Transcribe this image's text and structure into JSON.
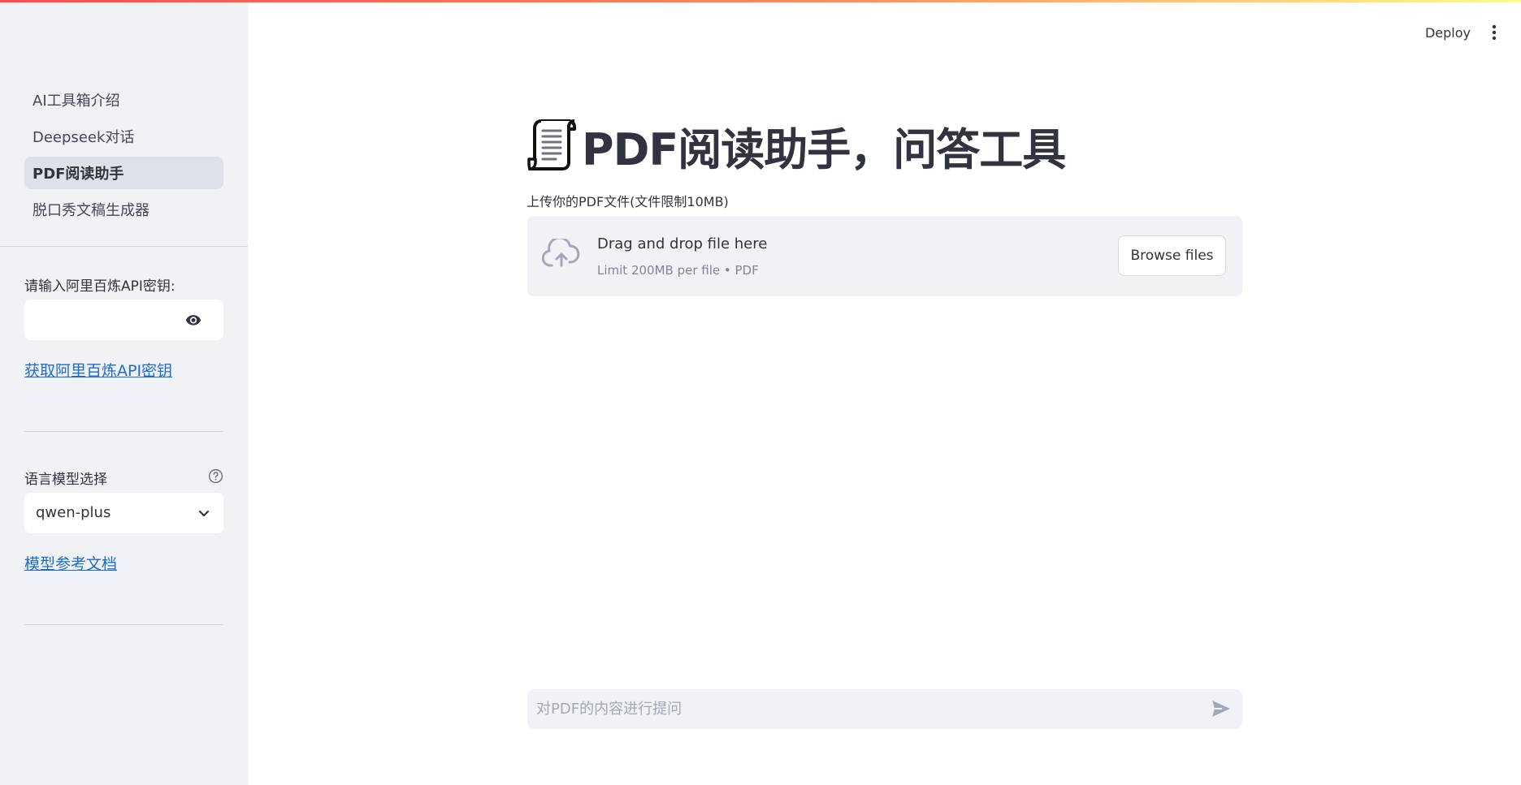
{
  "sidebar": {
    "nav": [
      {
        "label": "AI工具箱介绍",
        "active": false
      },
      {
        "label": "Deepseek对话",
        "active": false
      },
      {
        "label": "PDF阅读助手",
        "active": true
      },
      {
        "label": "脱口秀文稿生成器",
        "active": false
      }
    ],
    "api_key_label": "请输入阿里百炼API密钥:",
    "api_key_value": "",
    "api_key_link": "获取阿里百炼API密钥",
    "model_label": "语言模型选择",
    "model_selected": "qwen-plus",
    "model_docs_link": "模型参考文档"
  },
  "header": {
    "deploy_label": "Deploy"
  },
  "main": {
    "title": "PDF阅读助手，问答工具",
    "title_icon": "scroll-icon",
    "upload_label": "上传你的PDF文件(文件限制10MB)",
    "dropzone_title": "Drag and drop file here",
    "dropzone_subtitle": "Limit 200MB per file • PDF",
    "browse_label": "Browse files",
    "chat_placeholder": "对PDF的内容进行提问"
  },
  "colors": {
    "accent_gradient": [
      "#ff4b4b",
      "#fffd80"
    ],
    "sidebar_bg": "#f0f2f6",
    "link": "#1c6bd0",
    "text": "#31333f"
  }
}
